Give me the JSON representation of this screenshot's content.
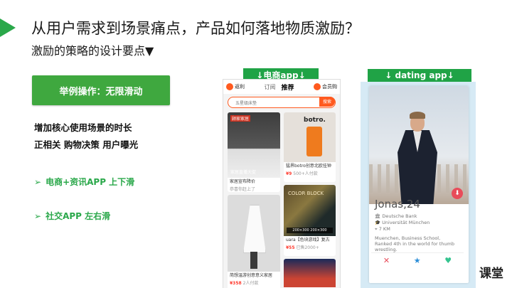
{
  "slide": {
    "title": "从用户需求到场景痛点，产品如何落地物质激励？",
    "subtitle": "激励的策略的设计要点▼",
    "example_button": "举例操作：无限滑动",
    "key_points": [
      "增加核心使用场景的时长",
      "正相关 购物决策 用户曝光"
    ],
    "bullets": [
      "电商+资讯APP 上下滑",
      "社交APP  左右滑"
    ],
    "watermark": "课堂"
  },
  "labels": {
    "ecommerce_tag": "↓电商app↓",
    "dating_tag": "↓ dating app↓"
  },
  "ecommerce_app": {
    "top_left": "返利",
    "tab_subscribe": "订阅",
    "tab_recommend": "推荐",
    "top_right": "会员购",
    "search_placeholder": "五星级床垫",
    "search_button": "搜索",
    "cards": [
      {
        "image_logo": "顾家家居",
        "image_caption": "家居直播大促",
        "title": "家居宣布降价",
        "sub": "恭喜你赶上了"
      },
      {
        "image_brand": "botro.",
        "title": "猛界botro创意北欧挂钟",
        "price": "¥9",
        "sub": "500+人付款"
      },
      {
        "image_text": "COLOR BLOCK",
        "image_dims": "200×300 200×300",
        "title": "uara【色块游戏】复古",
        "price": "¥55",
        "sub": "已售2000+"
      },
      {
        "title": "简想温游创意意义家居",
        "price": "¥358",
        "sub": "2人付款"
      }
    ]
  },
  "dating_app": {
    "name": "Jonas,24",
    "company": "Deutsche Bank",
    "university": "Universität München",
    "distance": "7 KM",
    "description": "Muenchen, Business School, Ranked 4th in the world for thumb wrestling.",
    "actions": [
      "✕",
      "★",
      "♥"
    ]
  },
  "colors": {
    "accent_green": "#2aa84a",
    "button_green": "#3fa83f",
    "ecommerce_orange": "#ff5a1f",
    "dating_bg": "#d6eaf5"
  }
}
